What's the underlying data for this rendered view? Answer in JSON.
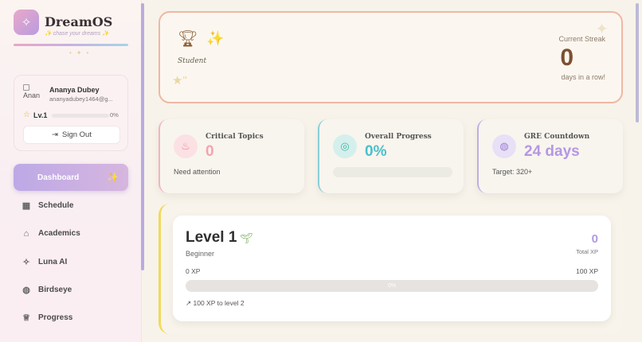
{
  "brand": {
    "name": "DreamOS",
    "tagline": "✨ chase your dreams ✨"
  },
  "profile": {
    "avatar_alt": "Anan",
    "name": "Ananya Dubey",
    "email": "ananyadubey1464@g...",
    "level": "Lv.1",
    "level_progress": "0%",
    "sign_out_label": "Sign Out"
  },
  "nav": {
    "items": [
      {
        "label": "Dashboard",
        "icon": "home-icon",
        "active": true
      },
      {
        "label": "Schedule",
        "icon": "calendar-icon"
      },
      {
        "label": "Academics",
        "icon": "graduation-cap-icon"
      },
      {
        "label": "Luna AI",
        "icon": "sparkles-icon"
      },
      {
        "label": "Birdseye",
        "icon": "globe-icon"
      },
      {
        "label": "Progress",
        "icon": "trophy-icon"
      }
    ]
  },
  "streak": {
    "role": "Student",
    "label": "Current Streak",
    "value": "0",
    "sub": "days in a row!"
  },
  "stats": {
    "critical": {
      "title": "Critical Topics",
      "value": "0",
      "sub": "Need attention"
    },
    "overall": {
      "title": "Overall Progress",
      "value": "0%",
      "progress": 0
    },
    "gre": {
      "title": "GRE Countdown",
      "value": "24 days",
      "sub": "Target: 320+"
    }
  },
  "level": {
    "title": "Level 1",
    "sub": "Beginner",
    "xp": "0",
    "xp_label": "Total XP",
    "min_label": "0 XP",
    "max_label": "100 XP",
    "bar_label": "0%",
    "progress": 0,
    "next": "100 XP to level 2"
  },
  "colors": {
    "accent": "#bda9e6",
    "streak_border": "#f0b7a4",
    "critical": "#f4a4ad",
    "overall": "#4bbfcc",
    "gre": "#b597e4",
    "level_accent": "#f1da5a"
  }
}
